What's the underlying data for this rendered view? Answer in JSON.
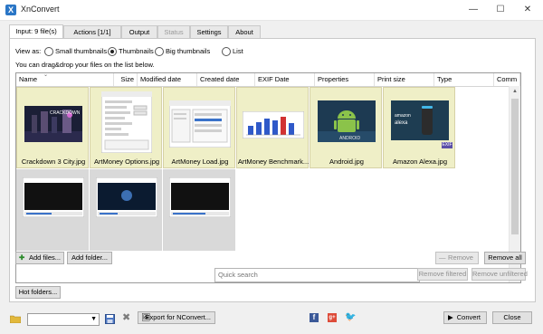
{
  "window": {
    "title": "XnConvert",
    "min": "—",
    "max": "☐",
    "close": "✕"
  },
  "tabs": [
    {
      "label": "Input: 9 file(s)",
      "state": "active"
    },
    {
      "label": "Actions [1/1]",
      "state": "normal"
    },
    {
      "label": "Output",
      "state": "normal"
    },
    {
      "label": "Status",
      "state": "disabled"
    },
    {
      "label": "Settings",
      "state": "normal"
    },
    {
      "label": "About",
      "state": "normal"
    }
  ],
  "view_as": {
    "label": "View as:",
    "options": [
      "Small thumbnails",
      "Thumbnails",
      "Big thumbnails",
      "List"
    ],
    "selected": "Thumbnails"
  },
  "hint": "You can drag&drop your files on the list below.",
  "columns": [
    "Name",
    "Size",
    "Modified date",
    "Created date",
    "EXIF Date",
    "Properties",
    "Print size",
    "Type",
    "Comm"
  ],
  "files": [
    {
      "name": "Crackdown 3 City.jpg",
      "icon": "game-city-thumbnail",
      "selected": true
    },
    {
      "name": "ArtMoney Options.jpg",
      "icon": "options-dialog-thumbnail",
      "selected": true
    },
    {
      "name": "ArtMoney Load.jpg",
      "icon": "load-dialog-thumbnail",
      "selected": true
    },
    {
      "name": "ArtMoney Benchmark...",
      "icon": "benchmark-chart-thumbnail",
      "selected": true
    },
    {
      "name": "Android.jpg",
      "icon": "android-thumbnail",
      "selected": true
    },
    {
      "name": "Amazon Alexa.jpg",
      "icon": "alexa-device-thumbnail",
      "badge": "EXIF",
      "selected": true
    },
    {
      "name": "",
      "icon": "media-player-thumbnail",
      "selected": false
    },
    {
      "name": "",
      "icon": "media-player-thumbnail",
      "selected": false
    },
    {
      "name": "",
      "icon": "media-player-thumbnail",
      "selected": false
    }
  ],
  "buttons": {
    "add_files": "Add files...",
    "add_folder": "Add folder...",
    "remove": "Remove",
    "remove_all": "Remove all",
    "remove_filtered": "Remove filtered",
    "remove_unfiltered": "Remove unfiltered",
    "hot_folders": "Hot folders...",
    "export": "Export for NConvert...",
    "convert": "Convert",
    "close": "Close"
  },
  "search": {
    "placeholder": "Quick search",
    "value": ""
  },
  "colors": {
    "selected_bg": "#efefc7",
    "thumb_bg": "#d9d9d9",
    "accent": "#2a76c6"
  }
}
